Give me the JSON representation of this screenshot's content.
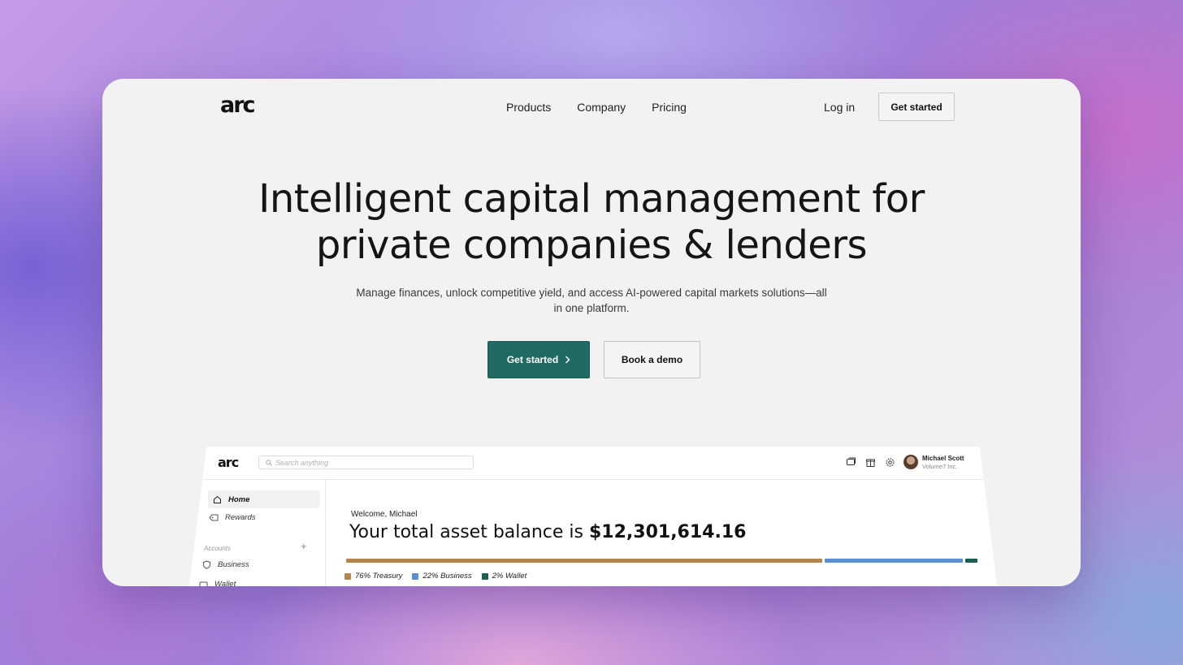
{
  "brand": {
    "logo_text": "arc"
  },
  "nav": {
    "items": [
      "Products",
      "Company",
      "Pricing"
    ],
    "login": "Log in",
    "get_started": "Get started"
  },
  "hero": {
    "title_line1": "Intelligent capital management for",
    "title_line2": "private companies & lenders",
    "subtitle": "Manage finances, unlock competitive yield, and access AI-powered capital markets solutions—all in one platform.",
    "cta_primary": "Get started",
    "cta_secondary": "Book a demo"
  },
  "app": {
    "logo_text": "arc",
    "search_placeholder": "Search anything",
    "user": {
      "name": "Michael Scott",
      "org": "Volume7 Inc."
    },
    "sidebar": {
      "home": "Home",
      "rewards": "Rewards",
      "accounts_label": "Accounts",
      "business": "Business",
      "wallet": "Wallet"
    },
    "welcome": "Welcome, Michael",
    "balance_prefix": "Your total asset balance is",
    "balance_amount": "$12,301,614.16",
    "allocation": [
      {
        "label": "76% Treasury",
        "percent": 76,
        "color": "#b3854f"
      },
      {
        "label": "22% Business",
        "percent": 22,
        "color": "#5a8fcf"
      },
      {
        "label": "2% Wallet",
        "percent": 2,
        "color": "#1b5e55"
      }
    ]
  },
  "colors": {
    "accent": "#1f6b63",
    "window_bg": "#f2f2f2"
  }
}
